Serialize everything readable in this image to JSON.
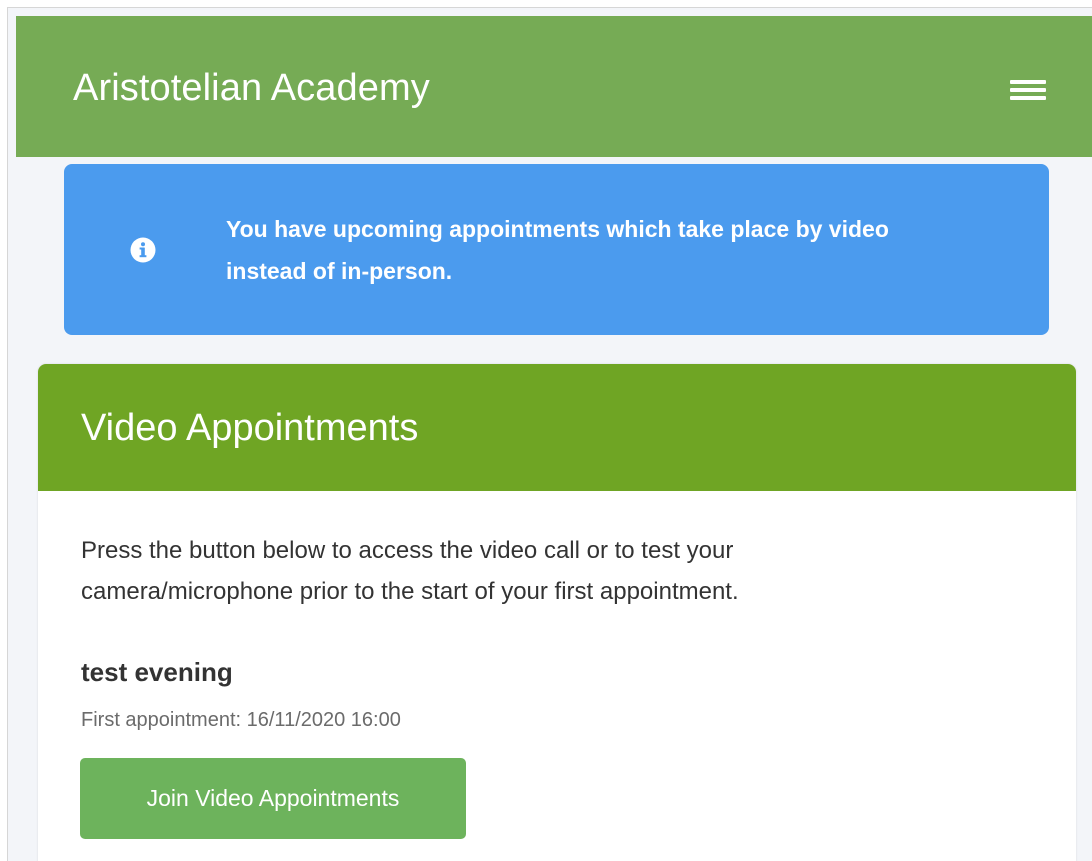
{
  "header": {
    "title": "Aristotelian Academy",
    "menu_icon": "hamburger-menu-icon",
    "color": "#76ab55"
  },
  "alert": {
    "icon": "info-icon",
    "line1": "You have upcoming appointments which take place by video",
    "line2": "instead of in-person.",
    "color": "#4b9bee"
  },
  "video_card": {
    "title": "Video Appointments",
    "header_color": "#6fa524",
    "description_line1": "Press the button below to access the video call or to test your",
    "description_line2": "camera/microphone prior to the start of your first appointment.",
    "event_name": "test evening",
    "first_appointment": "First appointment: 16/11/2020 16:00",
    "join_label": "Join Video Appointments",
    "button_color": "#6db35c"
  }
}
